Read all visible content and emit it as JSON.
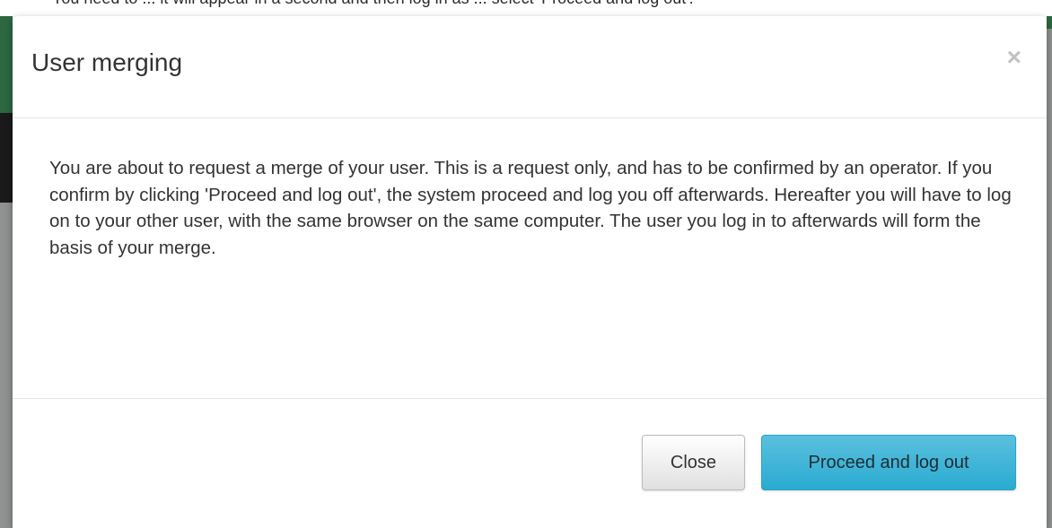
{
  "background": {
    "partial_text": "You need to ... it will appear in a second and then log in as ... select 'Proceed and log out'."
  },
  "modal": {
    "title": "User merging",
    "close_symbol": "×",
    "body_text": "You are about to request a merge of your user. This is a request only, and has to be confirmed by an operator. If you confirm by clicking 'Proceed and log out', the system proceed and log you off afterwards. Hereafter you will have to log on to your other user, with the same browser on the same computer. The user you log in to afterwards will form the basis of your merge.",
    "buttons": {
      "close_label": "Close",
      "proceed_label": "Proceed and log out"
    }
  },
  "colors": {
    "primary_button": "#5bc0de",
    "header_green": "#2e6842",
    "overlay_gray": "#8f9290"
  }
}
